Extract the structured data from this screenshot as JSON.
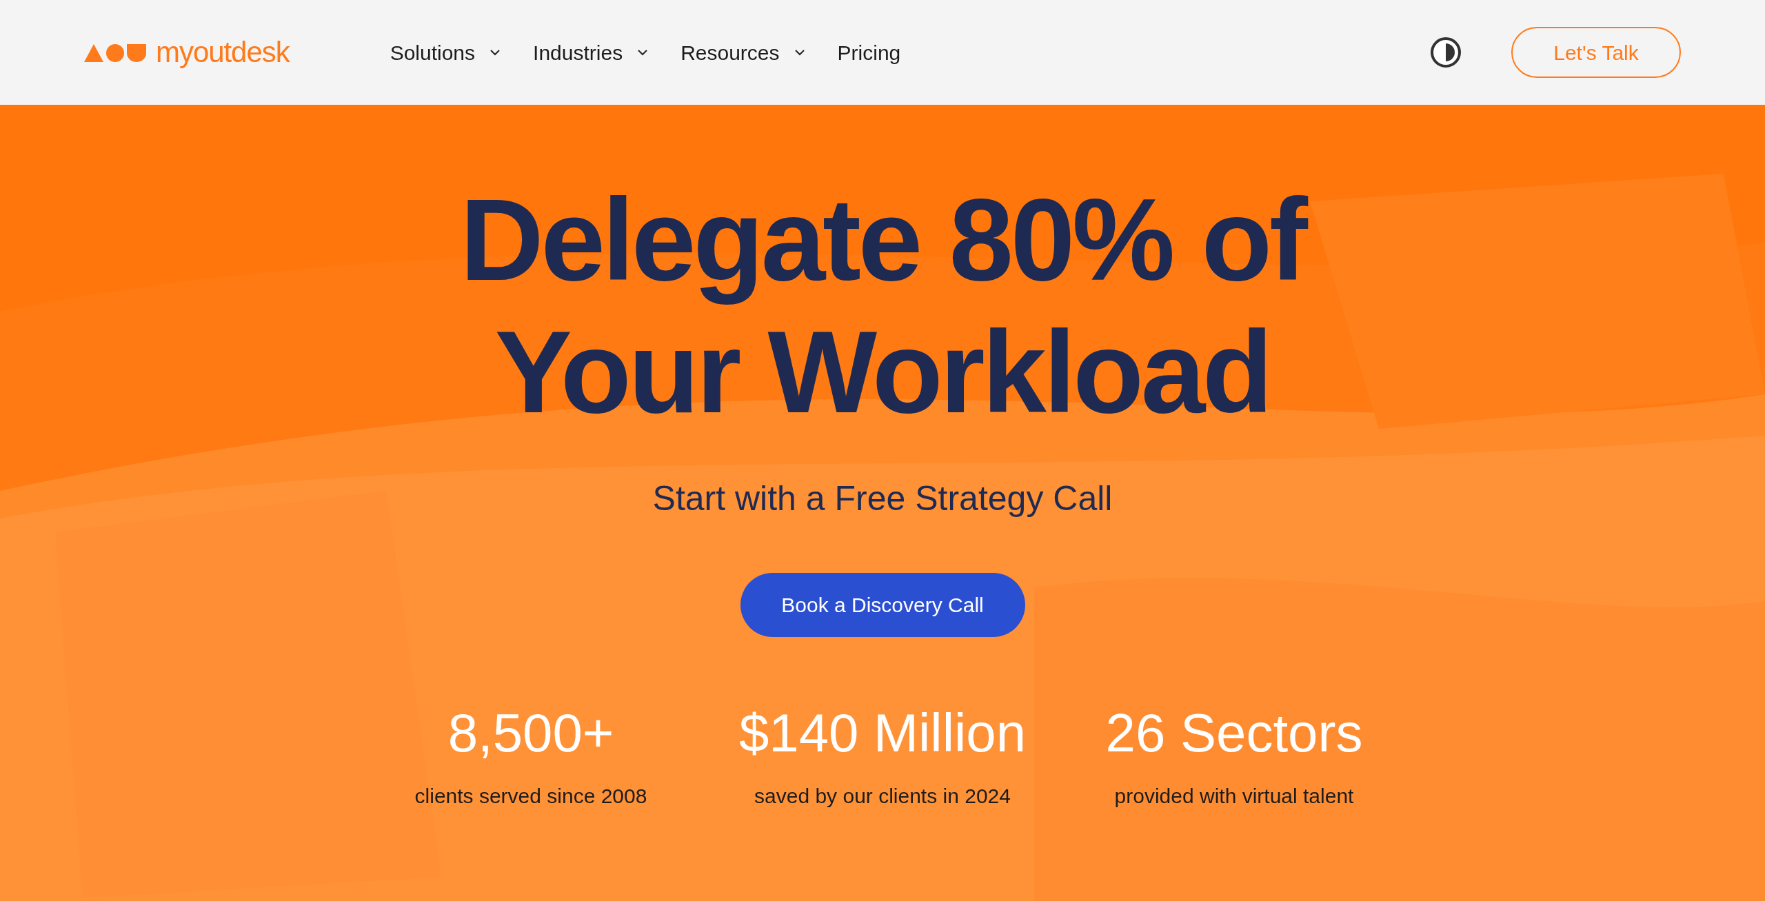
{
  "header": {
    "logo": "myoutdesk",
    "nav": [
      {
        "label": "Solutions",
        "dropdown": true
      },
      {
        "label": "Industries",
        "dropdown": true
      },
      {
        "label": "Resources",
        "dropdown": true
      },
      {
        "label": "Pricing",
        "dropdown": false
      }
    ],
    "cta": "Let's Talk"
  },
  "hero": {
    "kind": "picture",
    "headline_lines": [
      "Delegate 80% of",
      "Your Workload"
    ],
    "subtitle": "Start with a Free Strategy Call",
    "button": "Book a Discovery Call",
    "stats": [
      {
        "value": "8,500+",
        "label": "clients served since 2008"
      },
      {
        "value": "$140 Million",
        "label": "saved by our clients in 2024"
      },
      {
        "value": "26 Sectors",
        "label": "provided with virtual talent"
      }
    ]
  }
}
